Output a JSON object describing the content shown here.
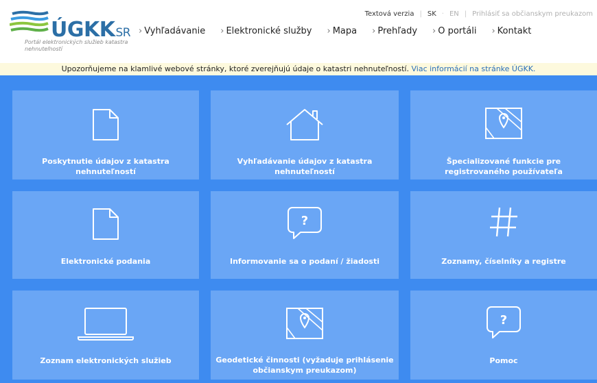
{
  "header": {
    "logo_text": "ÚGKK",
    "logo_suffix": "SR",
    "logo_subtitle": "Portál elektronických služieb katastra nehnuteľností",
    "top_links": {
      "text_version": "Textová verzia",
      "lang_sk": "SK",
      "lang_en": "EN",
      "login": "Prihlásiť sa občianskym preukazom"
    },
    "nav": [
      {
        "label": "Vyhľadávanie"
      },
      {
        "label": "Elektronické služby"
      },
      {
        "label": "Mapa"
      },
      {
        "label": "Prehľady"
      },
      {
        "label": "O portáli"
      },
      {
        "label": "Kontakt"
      }
    ]
  },
  "warning": {
    "text": "Upozorňujeme na klamlivé webové stránky, ktoré zverejňujú údaje o katastri nehnuteľností.",
    "link": "Viac informácií na stránke ÚGKK."
  },
  "colors": {
    "background": "#3e8bf0",
    "tile": "#6aa6f5",
    "warning_bg": "#fdf9dd",
    "link": "#2a6fb8"
  },
  "tiles": [
    {
      "label": "Poskytnutie údajov z katastra nehnuteľností",
      "icon": "document-icon"
    },
    {
      "label": "Vyhľadávanie údajov z katastra nehnuteľností",
      "icon": "house-icon"
    },
    {
      "label": "Špecializované funkcie pre registrovaného používateľa",
      "icon": "map-icon"
    },
    {
      "label": "Elektronické podania",
      "icon": "document-icon"
    },
    {
      "label": "Informovanie sa o podaní / žiadosti",
      "icon": "question-bubble-icon"
    },
    {
      "label": "Zoznamy, číselníky a registre",
      "icon": "hash-icon"
    },
    {
      "label": "Zoznam elektronických služieb",
      "icon": "laptop-icon"
    },
    {
      "label": "Geodetické činnosti (vyžaduje prihlásenie občianskym preukazom)",
      "icon": "map-icon"
    },
    {
      "label": "Pomoc",
      "icon": "question-bubble-icon"
    }
  ]
}
